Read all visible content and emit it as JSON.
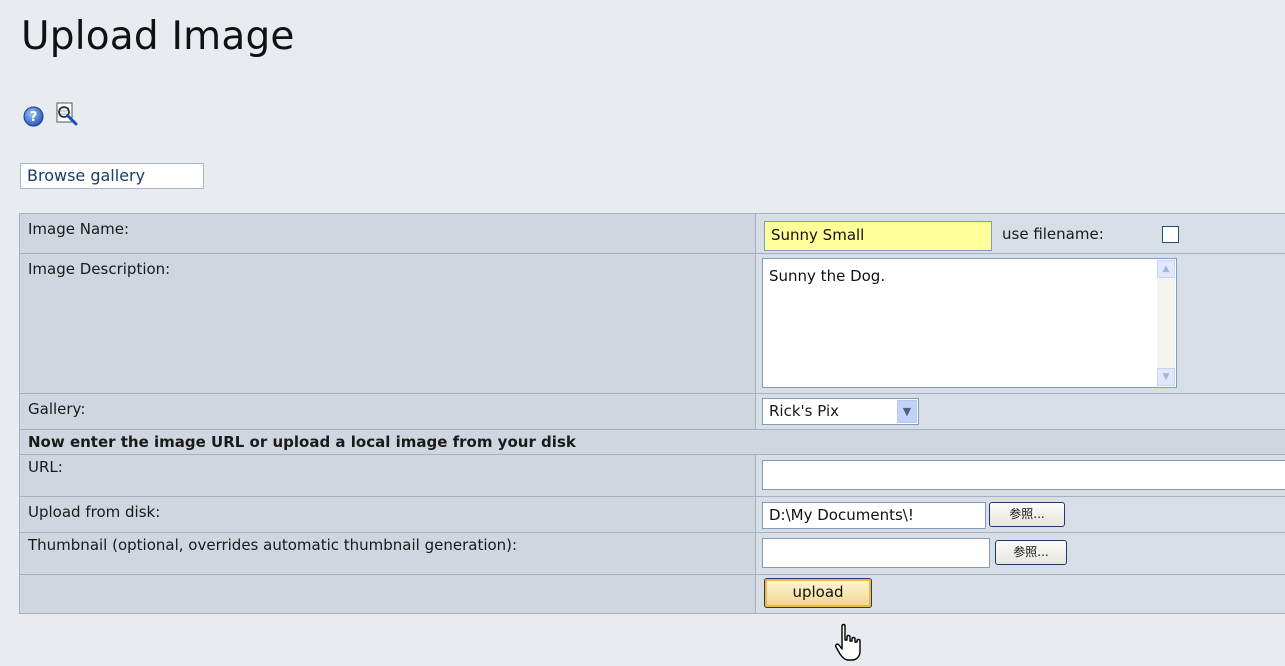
{
  "page": {
    "title": "Upload Image",
    "browse_gallery_label": "Browse gallery"
  },
  "icons": {
    "help": "help-icon",
    "search": "search-icon"
  },
  "form": {
    "image_name_label": "Image Name:",
    "image_name_value": "Sunny Small",
    "use_filename_label": "use filename:",
    "use_filename_checked": false,
    "image_description_label": "Image Description:",
    "image_description_value": "Sunny the Dog.",
    "gallery_label": "Gallery:",
    "gallery_selected": "Rick's Pix",
    "section_heading": "Now enter the image URL or upload a local image from your disk",
    "url_label": "URL:",
    "url_value": "",
    "upload_from_disk_label": "Upload from disk:",
    "upload_from_disk_value": "D:\\My Documents\\!",
    "browse_button_label": "参照...",
    "thumbnail_label": "Thumbnail (optional, overrides automatic thumbnail generation):",
    "thumbnail_value": "",
    "thumbnail_browse_label": "参照...",
    "upload_button_label": "upload"
  },
  "colors": {
    "page_bg": "#e8ecf1",
    "row_bg": "#cfd6df",
    "highlight_input": "#ffff99",
    "upload_button": "#f2d48a"
  }
}
